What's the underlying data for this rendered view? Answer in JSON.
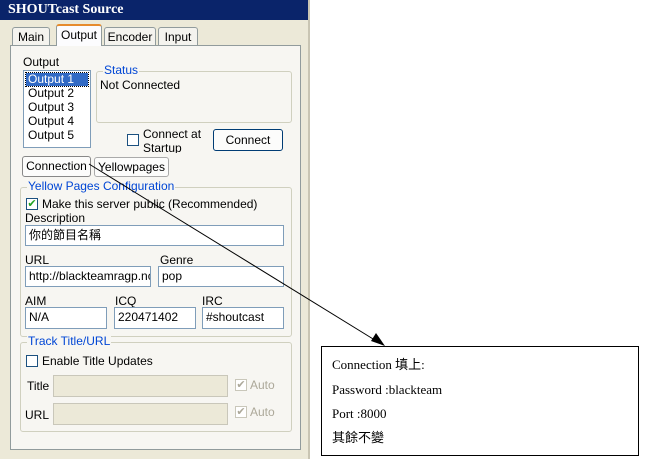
{
  "window": {
    "title": "SHOUTcast Source"
  },
  "tabs": [
    {
      "label": "Main"
    },
    {
      "label": "Output"
    },
    {
      "label": "Encoder"
    },
    {
      "label": "Input"
    }
  ],
  "output": {
    "label": "Output",
    "items": [
      "Output 1",
      "Output 2",
      "Output 3",
      "Output 4",
      "Output 5"
    ],
    "selected": "Output 1"
  },
  "status": {
    "legend": "Status",
    "text": "Not Connected"
  },
  "connect_at_startup": {
    "label_line1": "Connect at",
    "label_line2": "Startup",
    "checked": false
  },
  "connect_button": "Connect",
  "subtabs": [
    {
      "label": "Connection"
    },
    {
      "label": "Yellowpages"
    }
  ],
  "yellow_pages": {
    "legend": "Yellow Pages Configuration",
    "make_public": {
      "label": "Make this server public (Recommended)",
      "checked": true
    },
    "description": {
      "label": "Description",
      "value": "你的節目名稱"
    },
    "url": {
      "label": "URL",
      "value": "http://blackteamragp.nc"
    },
    "genre": {
      "label": "Genre",
      "value": "pop"
    },
    "aim": {
      "label": "AIM",
      "value": "N/A"
    },
    "icq": {
      "label": "ICQ",
      "value": "220471402"
    },
    "irc": {
      "label": "IRC",
      "value": "#shoutcast"
    }
  },
  "track_title": {
    "legend": "Track Title/URL",
    "enable_updates": {
      "label": "Enable Title Updates",
      "checked": false
    },
    "title": {
      "label": "Title",
      "value": "",
      "auto_label": "Auto"
    },
    "url": {
      "label": "URL",
      "value": "",
      "auto_label": "Auto"
    }
  },
  "annotation": {
    "lines": [
      "Connection  填上:",
      "Password :blackteam",
      "Port :8000",
      "其餘不變"
    ]
  },
  "colors": {
    "titlebar": "#0a246a",
    "legend": "#0046d5",
    "selection": "#316ac5",
    "tab_highlight": "#e68b2c"
  }
}
